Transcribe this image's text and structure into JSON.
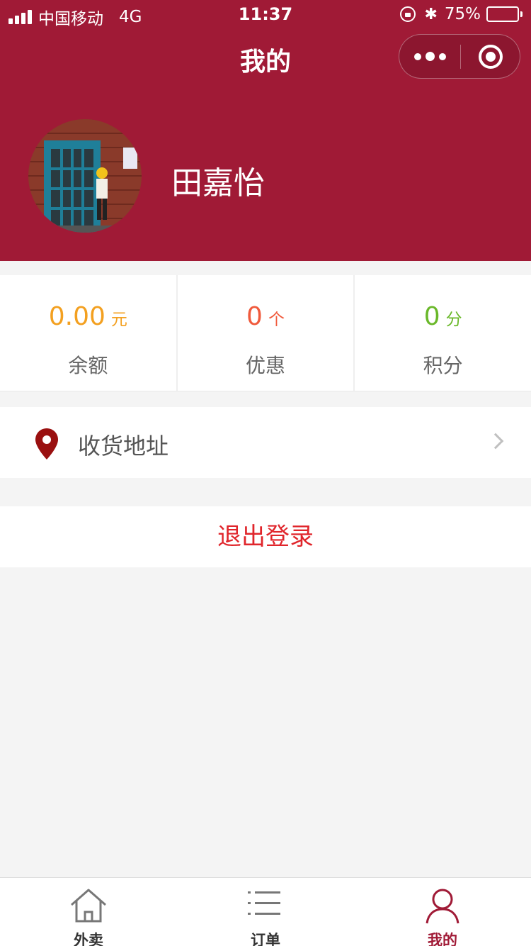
{
  "status_bar": {
    "carrier": "中国移动",
    "network": "4G",
    "time": "11:37",
    "battery": "75%",
    "battery_level": 0.75
  },
  "nav": {
    "title": "我的"
  },
  "profile": {
    "name": "田嘉怡"
  },
  "stats": [
    {
      "value": "0.00",
      "unit": "元",
      "label": "余额",
      "color": "#f3a020"
    },
    {
      "value": "0",
      "unit": "个",
      "label": "优惠",
      "color": "#f05a3c"
    },
    {
      "value": "0",
      "unit": "分",
      "label": "积分",
      "color": "#6ab82a"
    }
  ],
  "address": {
    "label": "收货地址",
    "icon": "location-pin-icon"
  },
  "logout": {
    "label": "退出登录"
  },
  "tabbar": {
    "items": [
      {
        "label": "外卖",
        "icon": "home-icon",
        "active": false
      },
      {
        "label": "订单",
        "icon": "list-icon",
        "active": false
      },
      {
        "label": "我的",
        "icon": "user-icon",
        "active": true
      }
    ]
  },
  "colors": {
    "brand": "#a01a36",
    "logout": "#e0252b"
  }
}
